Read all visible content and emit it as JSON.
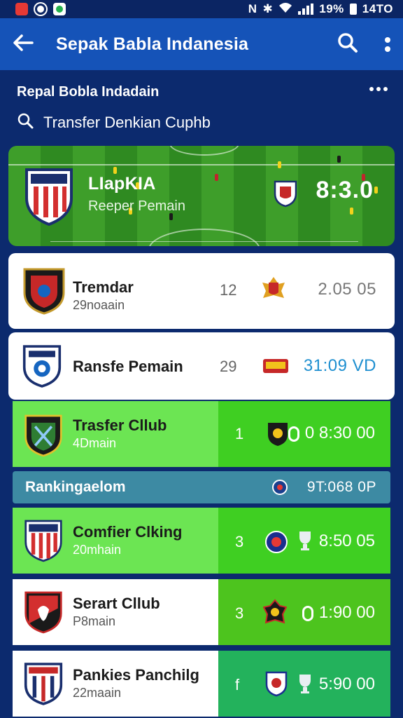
{
  "status_bar": {
    "time": "14TO",
    "battery": "19%",
    "icons": [
      "red-app-icon",
      "circle-app-icon",
      "green-app-icon",
      "nfc-icon",
      "bluetooth-icon",
      "wifi-icon",
      "signal-icon",
      "battery-icon"
    ]
  },
  "app_bar": {
    "title": "Sepak Babla Indanesia",
    "icons": [
      "back-arrow-icon",
      "search-icon",
      "more-vert-icon"
    ]
  },
  "sub_header": {
    "title": "Repal Bobla Indadain",
    "search_placeholder": "Transfer Denkian Cuphb"
  },
  "hero": {
    "team_name": "LIapKIA",
    "team_sub": "Reeper Pemain",
    "score": "8:3.0"
  },
  "matches": [
    {
      "name": "Tremdar",
      "sub": "29noaain",
      "num": "12",
      "time": "2.05 05",
      "style": "white"
    },
    {
      "name": "Ransfe Pemain",
      "sub": "",
      "num": "29",
      "time": "31:09 VD",
      "style": "white"
    },
    {
      "name": "Trasfer Cllub",
      "sub": "4Dmain",
      "num": "1",
      "time": "0 8:30 00",
      "style": "green"
    },
    {
      "name": "Comfier Clking",
      "sub": "20mhain",
      "num": "3",
      "time": "8:50 05",
      "style": "green"
    },
    {
      "name": "Serart Cllub",
      "sub": "P8main",
      "num": "3",
      "time": "1:90 00",
      "style": "split-green"
    },
    {
      "name": "Pankies Panchilg",
      "sub": "22maain",
      "num": "f",
      "time": "5:90 00",
      "style": "split-teal"
    }
  ],
  "ranking": {
    "label": "Rankingaelom",
    "time": "9T:068 0P"
  },
  "colors": {
    "app_bar": "#1553b8",
    "background": "#0c2a6e",
    "green": "#5fe03f",
    "dark_green": "#3bbf1e",
    "teal": "#3d8aa3",
    "time_blue": "#1e8fd0"
  }
}
